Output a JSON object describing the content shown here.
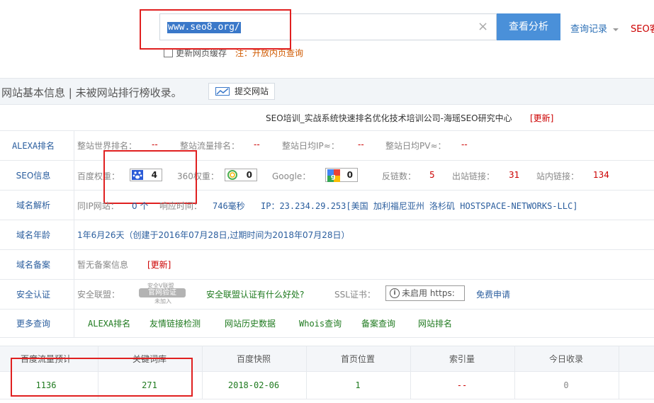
{
  "search": {
    "value": "www.seo8.org/",
    "clear_icon": "×",
    "button": "查看分析",
    "history": "查询记录",
    "history_icon": "chevron-down",
    "seo_label": "SEO客"
  },
  "options": {
    "refresh_cache": "更新网页缓存",
    "note": "注：开放内页查询"
  },
  "header": {
    "title": "网站基本信息 | 未被网站排行榜收录。",
    "submit": "提交网站"
  },
  "site": {
    "title": "SEO培训_实战系统快速排名优化技术培训公司-海瑶SEO研究中心",
    "update": "[更新]"
  },
  "rows": {
    "alexa": {
      "label": "ALEXA排名",
      "world_label": "整站世界排名：",
      "world": "--",
      "flow_label": "整站流量排名：",
      "flow": "--",
      "ip_label": "整站日均IP≈：",
      "ip": "--",
      "pv_label": "整站日均PV≈：",
      "pv": "--"
    },
    "seo": {
      "label": "SEO信息",
      "baidu_label": "百度权重：",
      "baidu": "4",
      "w360_label": "360权重：",
      "w360": "0",
      "google_label": "Google：",
      "google": "0",
      "backlinks_label": "反链数：",
      "backlinks": "5",
      "outlinks_label": "出站链接：",
      "outlinks": "31",
      "inlinks_label": "站内链接：",
      "inlinks": "134"
    },
    "dns": {
      "label": "域名解析",
      "sameip_label": "同IP网站：",
      "sameip": "0 个",
      "resp_label": "响应时间：",
      "resp": "746毫秒",
      "ip_text": "IP：23.234.29.253[美国 加利福尼亚州 洛杉矶 HOSTSPACE-NETWORKS-LLC]"
    },
    "age": {
      "label": "域名年龄",
      "text": "1年6月26天（创建于2016年07月28日,过期时间为2018年07月28日）"
    },
    "icp": {
      "label": "域名备案",
      "text": "暂无备案信息",
      "update": "[更新]"
    },
    "security": {
      "label": "安全认证",
      "alliance_label": "安全联盟：",
      "seal_top": "安全V联盟",
      "seal_main": "官网验证",
      "seal_bottom": "未加入",
      "question": "安全联盟认证有什么好处?",
      "ssl_label": "SSL证书：",
      "ssl_badge": "未启用 https:",
      "free": "免费申请"
    },
    "more": {
      "label": "更多查询",
      "links": [
        "ALEXA排名",
        "友情链接检测",
        "网站历史数据",
        "Whois查询",
        "备案查询",
        "网站排名"
      ]
    }
  },
  "table": {
    "headers": [
      "百度流量预计",
      "关键词库",
      "百度快照",
      "首页位置",
      "索引量",
      "今日收录"
    ],
    "values": [
      "1136",
      "271",
      "2018-02-06",
      "1",
      "--",
      "0"
    ]
  },
  "colors": {
    "accent": "#4a90d9",
    "link": "#2b5e9e",
    "red": "#cc0000",
    "green": "#1f7a1f"
  }
}
